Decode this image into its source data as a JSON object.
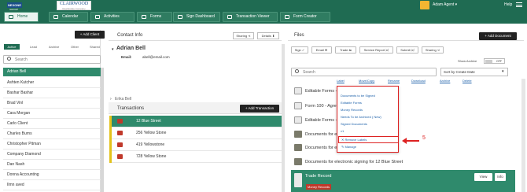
{
  "brand": {
    "logo1": "NEXONE",
    "logo1_sub": "GROUP",
    "logo2": "CLAIRWOOD",
    "logo2_sub": "Real Estate Company"
  },
  "nav": [
    {
      "label": "Home"
    },
    {
      "label": "Calendar"
    },
    {
      "label": "Activities"
    },
    {
      "label": "Forms"
    },
    {
      "label": "Sign Dashboard"
    },
    {
      "label": "Transaction Viewer"
    },
    {
      "label": "Form Creator"
    }
  ],
  "header": {
    "user": "Adam Agent ▾",
    "help": "Help"
  },
  "clients": {
    "add_label": "+ Add Client",
    "tabs": [
      "Active",
      "Lead",
      "Archive",
      "Other",
      "Shared"
    ],
    "search_placeholder": "Search",
    "selected": "Adrian Bell",
    "items": [
      "Ashten Kutcher",
      "Bashar Bashar",
      "Brad Vinl",
      "Cara Morgan",
      "Carlo Client",
      "Charles Burns",
      "Christopher Pitman",
      "Company Diamond",
      "Dan Nash",
      "Donna Accounting",
      "Ilmn aved"
    ]
  },
  "contact": {
    "title": "Contact Info",
    "share": "Sharing ⋖",
    "details": "Details ⬍",
    "name": "Adrian Bell",
    "email_label": "Email:",
    "email": "abell@email.com",
    "other_contact": "Erika Bell"
  },
  "transactions": {
    "title": "Transactions",
    "add": "+ Add Transaction",
    "items": [
      "12 Blue Street",
      "256 Yellow Stone",
      "419 Yellowstone",
      "728 Yellow Stone"
    ]
  },
  "files": {
    "title": "Files",
    "add": "+ Add Document",
    "toolbar": [
      "Sign ✓",
      "Email ✉",
      "Trade ⇆",
      "Service Report 🗐",
      "Submit 🗐",
      "Sharing ⋖"
    ],
    "show_archive": "Show Archive",
    "toggle": "OFF",
    "search_placeholder": "Search",
    "sort": "Sort by Create Date",
    "actions": [
      "Label",
      "Move/Copy",
      "Rename",
      "Download",
      "Archive",
      "Delete"
    ],
    "items": [
      {
        "name": "Editable Forms -",
        "type": "doc"
      },
      {
        "name": "Form 100 - Agre",
        "type": "doc"
      },
      {
        "name": "Editable Forms -",
        "type": "doc"
      },
      {
        "name": "Documents for el",
        "type": "folder"
      },
      {
        "name": "Documents for el",
        "type": "folder"
      },
      {
        "name": "Documents for electronic signing for 12 Blue Street",
        "type": "folder"
      }
    ],
    "record_title": "Trade Record",
    "record_badge": "Money Records",
    "view": "View",
    "info": "Info"
  },
  "menu": {
    "items": [
      "Documents to be Signed",
      "Editable Forms",
      "Money Records",
      "Needs To be Archived ( New)",
      "Signed Documents",
      "v1"
    ],
    "remove": "✕ Remove Labels",
    "manage": "✎ Manage"
  },
  "callout": "5"
}
